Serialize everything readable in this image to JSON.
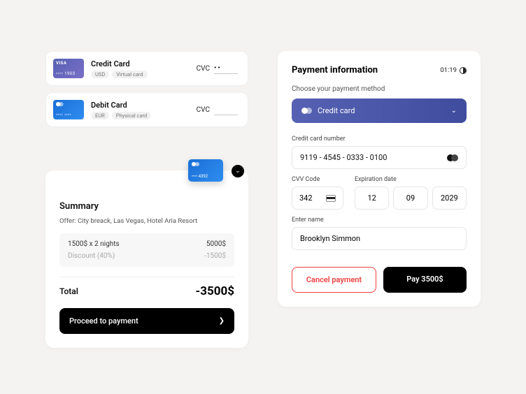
{
  "cards": [
    {
      "brand": "VISA",
      "last4": "•••• 1903",
      "title": "Credit Card",
      "tags": [
        "USD",
        "Virtual card"
      ],
      "cvc_label": "CVC",
      "cvc_value": "••"
    },
    {
      "brand": "mc",
      "last4": "•••• ••••",
      "title": "Debit Card",
      "tags": [
        "EUR",
        "Physical card"
      ],
      "cvc_label": "CVC",
      "cvc_value": ""
    }
  ],
  "summary": {
    "mini_last4": "•••• 4392",
    "heading": "Summary",
    "offer": "Offer: City breack, Las Vegas, Hotel Aria Resort",
    "line1_left": "1500$ x 2 nights",
    "line1_right": "5000$",
    "line2_left": "Discount (40%)",
    "line2_right": "-1500$",
    "total_label": "Total",
    "total_value": "-3500$",
    "proceed": "Proceed to payment"
  },
  "payment": {
    "title": "Payment information",
    "timer": "01:19",
    "choose": "Choose your payment method",
    "method": "Credit card",
    "cc_label": "Credit card number",
    "cc_value": "9119 - 4545 - 0333 - 0100",
    "cvv_label": "CVV Code",
    "cvv_value": "342",
    "exp_label": "Expiration date",
    "exp_d": "12",
    "exp_m": "09",
    "exp_y": "2029",
    "name_label": "Enter name",
    "name_value": "Brooklyn Simmon",
    "cancel": "Cancel payment",
    "pay": "Pay 3500$"
  }
}
